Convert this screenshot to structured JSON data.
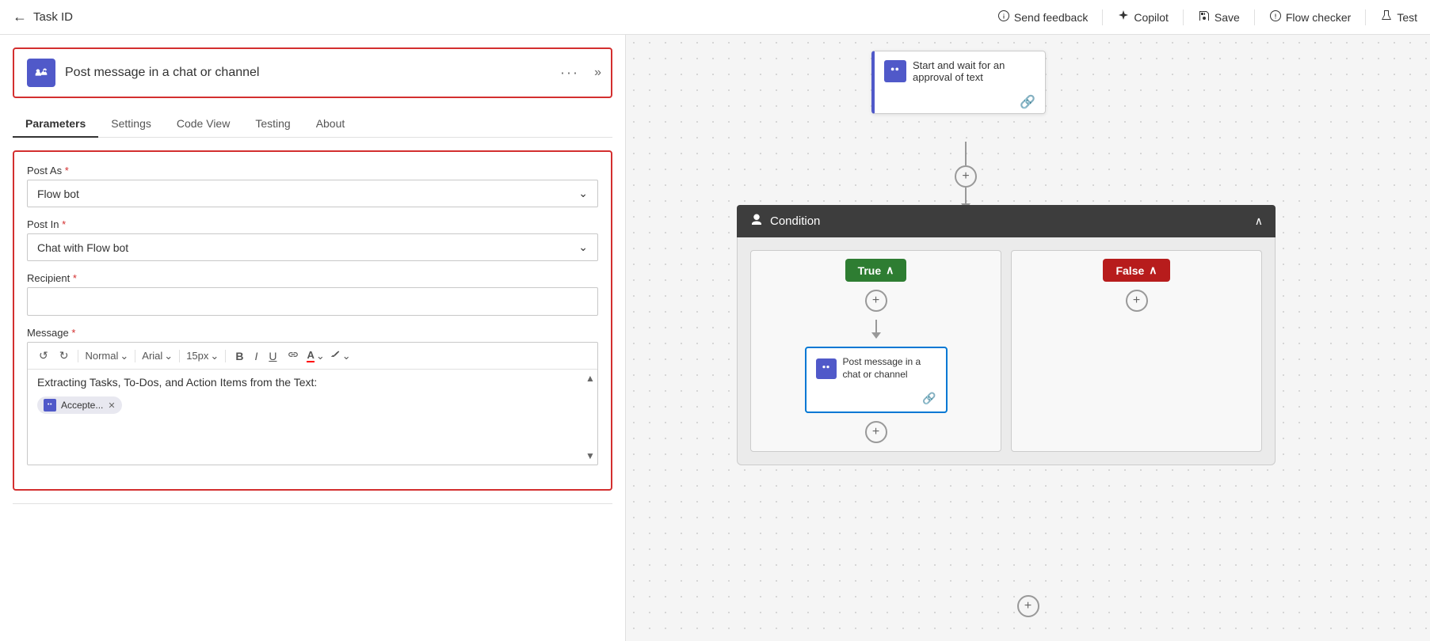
{
  "topbar": {
    "back_icon": "←",
    "title": "Task ID",
    "actions": [
      {
        "id": "send-feedback",
        "icon": "👤",
        "label": "Send feedback"
      },
      {
        "id": "copilot",
        "icon": "✨",
        "label": "Copilot"
      },
      {
        "id": "save",
        "icon": "💾",
        "label": "Save"
      },
      {
        "id": "flow-checker",
        "icon": "🩺",
        "label": "Flow checker"
      },
      {
        "id": "test",
        "icon": "🧪",
        "label": "Test"
      }
    ]
  },
  "left_panel": {
    "action_title": "Post message in a chat or channel",
    "tabs": [
      {
        "id": "parameters",
        "label": "Parameters",
        "active": true
      },
      {
        "id": "settings",
        "label": "Settings",
        "active": false
      },
      {
        "id": "code-view",
        "label": "Code View",
        "active": false
      },
      {
        "id": "testing",
        "label": "Testing",
        "active": false
      },
      {
        "id": "about",
        "label": "About",
        "active": false
      }
    ],
    "form": {
      "post_as_label": "Post As",
      "post_as_value": "Flow bot",
      "post_in_label": "Post In",
      "post_in_value": "Chat with Flow bot",
      "recipient_label": "Recipient",
      "recipient_value": "",
      "message_label": "Message",
      "message_text": "Extracting Tasks, To-Dos, and Action Items from the Text:",
      "message_tag": "Accepte...",
      "toolbar": {
        "undo": "↺",
        "redo": "↻",
        "style": "Normal",
        "font": "Arial",
        "size": "15px",
        "bold": "B",
        "italic": "I",
        "underline": "U",
        "link": "🔗",
        "font_color": "A",
        "highlight": "🖊"
      }
    }
  },
  "canvas": {
    "approval_node": {
      "title": "Start and wait for an approval of text"
    },
    "condition_node": {
      "title": "Condition",
      "true_label": "True",
      "false_label": "False",
      "post_message_title": "Post message in a chat or channel"
    },
    "colors": {
      "teams_icon_bg": "#5059c9",
      "condition_header_bg": "#3d3d3d",
      "true_bg": "#2e7d32",
      "false_bg": "#b71c1c",
      "post_border": "#0078d4",
      "approval_left": "#5059c9"
    }
  }
}
